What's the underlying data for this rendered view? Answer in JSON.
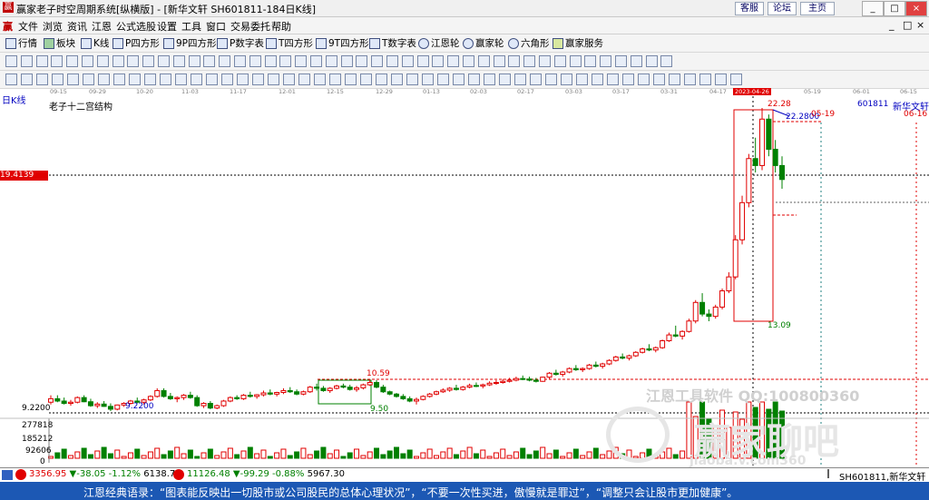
{
  "window": {
    "logo": "赢",
    "title": "赢家老子时空周期系统[纵横版] - [新华文轩  SH601811-184日K线]",
    "links": [
      "客服",
      "论坛",
      "主页"
    ],
    "controls": [
      "_",
      "□",
      "×"
    ]
  },
  "menu": {
    "logo": "赢",
    "items": [
      "文件",
      "浏览",
      "资讯",
      "江恩",
      "公式选股",
      "设置",
      "工具",
      "窗口",
      "交易委托",
      "帮助"
    ],
    "mdi_controls": [
      "_",
      "□",
      "×"
    ]
  },
  "toolbar1": {
    "items": [
      "行情",
      "板块",
      "K线",
      "P四方形",
      "9P四方形",
      "P数字表",
      "T四方形",
      "9T四方形",
      "T数字表",
      "江恩轮",
      "赢家轮",
      "六角形",
      "赢家服务"
    ]
  },
  "date_axis": {
    "labels": [
      "09-15",
      "09-29",
      "10-20",
      "11-03",
      "11-17",
      "12-01",
      "12-15",
      "12-29",
      "01-13",
      "02-03",
      "02-17",
      "03-03",
      "03-17",
      "03-31",
      "04-17",
      "2023-04-26",
      "05-19",
      "06-01",
      "06-15"
    ]
  },
  "chart": {
    "period_label": "日K线",
    "structure_label": "老子十二宫结构",
    "stock_code": "601811",
    "stock_name": "新华文轩",
    "price_marker": "19.4139",
    "high_label": "22.28",
    "high_value": "22.2800",
    "top_date_1": "05-19",
    "top_date_2": "06-16",
    "low_label": "13.09",
    "level_1": "10.59",
    "level_2": "9.50",
    "base_label": "9.2200",
    "base_value": "9.2200",
    "vol_axis": [
      "277818",
      "185212",
      "92606",
      "0"
    ],
    "colors": {
      "up": "#e00000",
      "down": "#008000",
      "grid": "#e00000",
      "marker": "#e00000"
    }
  },
  "watermark": {
    "line1": "江恩工具软件  QQ:100800360",
    "line2": "赢家聊吧",
    "line3": "jiaoba.v.com360"
  },
  "status": {
    "sh_value": "3356.95",
    "sh_change": "▼-38.05",
    "sh_pct": "-1.12%",
    "sh_amount": "6138.78",
    "sz_value": "11126.48",
    "sz_change": "▼-99.29",
    "sz_pct": "-0.88%",
    "sz_amount": "5967.30",
    "right": "SH601811,新华文轩"
  },
  "quote": "江恩经典语录：“图表能反映出一切股市或公司股民的总体心理状况”，“不要一次性买进，傲慢就是罪过”，“调整只会让股市更加健康”。",
  "candles": [
    [
      9.6,
      9.9,
      9.5,
      9.75
    ],
    [
      9.75,
      9.9,
      9.6,
      9.65
    ],
    [
      9.65,
      9.8,
      9.5,
      9.55
    ],
    [
      9.55,
      9.7,
      9.45,
      9.6
    ],
    [
      9.6,
      9.85,
      9.55,
      9.8
    ],
    [
      9.8,
      9.9,
      9.6,
      9.62
    ],
    [
      9.62,
      9.75,
      9.4,
      9.45
    ],
    [
      9.45,
      9.6,
      9.35,
      9.52
    ],
    [
      9.52,
      9.65,
      9.4,
      9.42
    ],
    [
      9.42,
      9.55,
      9.22,
      9.3
    ],
    [
      9.3,
      9.5,
      9.25,
      9.48
    ],
    [
      9.48,
      9.6,
      9.4,
      9.55
    ],
    [
      9.55,
      9.7,
      9.5,
      9.65
    ],
    [
      9.65,
      9.8,
      9.55,
      9.6
    ],
    [
      9.6,
      9.75,
      9.5,
      9.7
    ],
    [
      9.7,
      9.9,
      9.65,
      9.85
    ],
    [
      9.85,
      10.2,
      9.8,
      10.1
    ],
    [
      10.1,
      10.2,
      9.8,
      9.85
    ],
    [
      9.85,
      10.0,
      9.7,
      9.75
    ],
    [
      9.75,
      9.85,
      9.6,
      9.8
    ],
    [
      9.8,
      9.95,
      9.7,
      9.9
    ],
    [
      9.9,
      10.05,
      9.75,
      9.8
    ],
    [
      9.8,
      9.9,
      9.4,
      9.45
    ],
    [
      9.45,
      9.6,
      9.35,
      9.55
    ],
    [
      9.55,
      9.65,
      9.3,
      9.35
    ],
    [
      9.35,
      9.5,
      9.3,
      9.45
    ],
    [
      9.45,
      9.7,
      9.4,
      9.65
    ],
    [
      9.65,
      9.85,
      9.6,
      9.8
    ],
    [
      9.8,
      9.9,
      9.7,
      9.75
    ],
    [
      9.75,
      9.95,
      9.7,
      9.9
    ],
    [
      9.9,
      10.05,
      9.8,
      9.85
    ],
    [
      9.85,
      9.95,
      9.75,
      9.92
    ],
    [
      9.92,
      10.1,
      9.85,
      10.0
    ],
    [
      10.0,
      10.15,
      9.9,
      9.95
    ],
    [
      9.95,
      10.05,
      9.85,
      10.02
    ],
    [
      10.02,
      10.2,
      9.95,
      10.1
    ],
    [
      10.1,
      10.25,
      10.0,
      10.05
    ],
    [
      10.05,
      10.15,
      9.9,
      9.95
    ],
    [
      9.95,
      10.1,
      9.9,
      10.05
    ],
    [
      10.05,
      10.3,
      10.0,
      10.25
    ],
    [
      10.25,
      10.4,
      10.1,
      10.2
    ],
    [
      10.2,
      10.3,
      10.05,
      10.1
    ],
    [
      10.1,
      10.25,
      10.0,
      10.2
    ],
    [
      10.2,
      10.35,
      10.15,
      10.3
    ],
    [
      10.3,
      10.4,
      10.2,
      10.25
    ],
    [
      10.25,
      10.35,
      10.1,
      10.15
    ],
    [
      10.15,
      10.3,
      10.05,
      10.22
    ],
    [
      10.22,
      10.4,
      10.15,
      10.35
    ],
    [
      10.35,
      10.59,
      10.3,
      10.45
    ],
    [
      10.45,
      10.55,
      10.2,
      10.25
    ],
    [
      10.25,
      10.35,
      10.0,
      10.05
    ],
    [
      10.05,
      10.1,
      9.9,
      9.95
    ],
    [
      9.95,
      10.0,
      9.8,
      9.85
    ],
    [
      9.85,
      9.95,
      9.7,
      9.75
    ],
    [
      9.75,
      9.85,
      9.6,
      9.65
    ],
    [
      9.65,
      9.8,
      9.5,
      9.72
    ],
    [
      9.72,
      9.9,
      9.68,
      9.85
    ],
    [
      9.85,
      10.0,
      9.8,
      9.95
    ],
    [
      9.95,
      10.1,
      9.9,
      10.05
    ],
    [
      10.05,
      10.2,
      10.0,
      10.12
    ],
    [
      10.12,
      10.25,
      10.05,
      10.2
    ],
    [
      10.2,
      10.35,
      10.1,
      10.15
    ],
    [
      10.15,
      10.3,
      10.1,
      10.25
    ],
    [
      10.25,
      10.4,
      10.2,
      10.32
    ],
    [
      10.32,
      10.45,
      10.25,
      10.3
    ],
    [
      10.3,
      10.4,
      10.2,
      10.35
    ],
    [
      10.35,
      10.5,
      10.3,
      10.42
    ],
    [
      10.42,
      10.55,
      10.35,
      10.45
    ],
    [
      10.45,
      10.6,
      10.4,
      10.5
    ],
    [
      10.5,
      10.65,
      10.45,
      10.55
    ],
    [
      10.55,
      10.7,
      10.5,
      10.62
    ],
    [
      10.62,
      10.75,
      10.55,
      10.6
    ],
    [
      10.6,
      10.7,
      10.5,
      10.55
    ],
    [
      10.55,
      10.65,
      10.45,
      10.5
    ],
    [
      10.5,
      10.7,
      10.48,
      10.68
    ],
    [
      10.68,
      10.9,
      10.6,
      10.85
    ],
    [
      10.85,
      11.0,
      10.75,
      10.8
    ],
    [
      10.8,
      10.95,
      10.7,
      10.9
    ],
    [
      10.9,
      11.1,
      10.85,
      11.05
    ],
    [
      11.05,
      11.2,
      10.95,
      11.0
    ],
    [
      11.0,
      11.1,
      10.9,
      11.05
    ],
    [
      11.05,
      11.25,
      11.0,
      11.2
    ],
    [
      11.2,
      11.35,
      11.1,
      11.15
    ],
    [
      11.15,
      11.3,
      11.05,
      11.25
    ],
    [
      11.25,
      11.45,
      11.2,
      11.4
    ],
    [
      11.4,
      11.6,
      11.35,
      11.55
    ],
    [
      11.55,
      11.7,
      11.45,
      11.5
    ],
    [
      11.5,
      11.65,
      11.4,
      11.6
    ],
    [
      11.6,
      11.8,
      11.55,
      11.75
    ],
    [
      11.75,
      11.95,
      11.7,
      11.9
    ],
    [
      11.9,
      12.1,
      11.8,
      11.85
    ],
    [
      11.85,
      12.0,
      11.75,
      11.95
    ],
    [
      11.95,
      12.3,
      11.9,
      12.25
    ],
    [
      12.25,
      12.6,
      12.2,
      12.5
    ],
    [
      12.5,
      12.9,
      12.4,
      12.45
    ],
    [
      12.45,
      12.7,
      12.3,
      12.65
    ],
    [
      12.65,
      13.2,
      12.6,
      13.1
    ],
    [
      13.1,
      14.0,
      13.0,
      13.9
    ],
    [
      13.9,
      14.3,
      13.3,
      13.4
    ],
    [
      13.4,
      13.6,
      13.09,
      13.3
    ],
    [
      13.3,
      13.8,
      13.2,
      13.7
    ],
    [
      13.7,
      14.5,
      13.6,
      14.4
    ],
    [
      14.4,
      15.2,
      14.3,
      15.0
    ],
    [
      15.0,
      16.8,
      14.9,
      16.6
    ],
    [
      16.6,
      18.5,
      16.4,
      18.2
    ],
    [
      18.2,
      20.3,
      18.0,
      20.1
    ],
    [
      20.1,
      21.0,
      19.5,
      19.8
    ],
    [
      19.8,
      22.28,
      19.6,
      21.8
    ],
    [
      21.8,
      22.0,
      20.2,
      20.5
    ],
    [
      20.5,
      20.9,
      19.5,
      19.8
    ],
    [
      19.8,
      20.2,
      18.8,
      19.2
    ]
  ]
}
